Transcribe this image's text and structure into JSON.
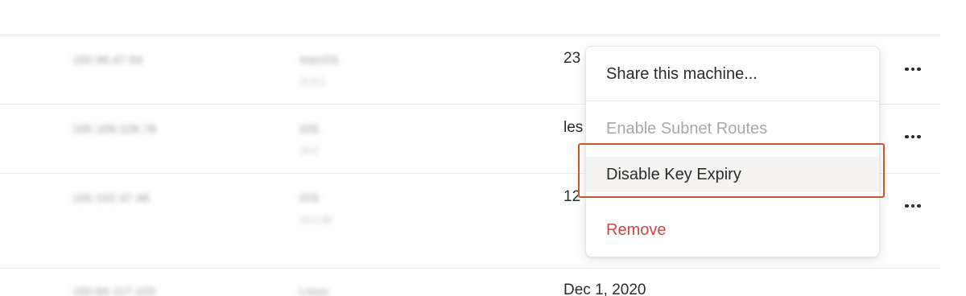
{
  "machines": [
    {
      "address": "100.96.47.64",
      "os_main": "macOS",
      "os_sub": "11.0.1",
      "last_seen": "23"
    },
    {
      "address": "100.109.228.78",
      "os_main": "iOS",
      "os_sub": "14.2",
      "last_seen": "les"
    },
    {
      "address": "100.102.47.46",
      "os_main": "iOS",
      "os_sub": "14.2.0b",
      "last_seen": "12"
    },
    {
      "address": "100.84.117.103",
      "os_main": "Linux",
      "os_sub": "",
      "last_seen": "Dec 1, 2020"
    }
  ],
  "context_menu": {
    "share": "Share this machine...",
    "subnet_routes": "Enable Subnet Routes",
    "disable_key_expiry": "Disable Key Expiry",
    "remove": "Remove"
  },
  "icons": {
    "more": "more-horizontal-icon"
  },
  "colors": {
    "danger": "#d04841",
    "disabled": "#a8a8a8",
    "highlight_outline": "#c8562e"
  }
}
